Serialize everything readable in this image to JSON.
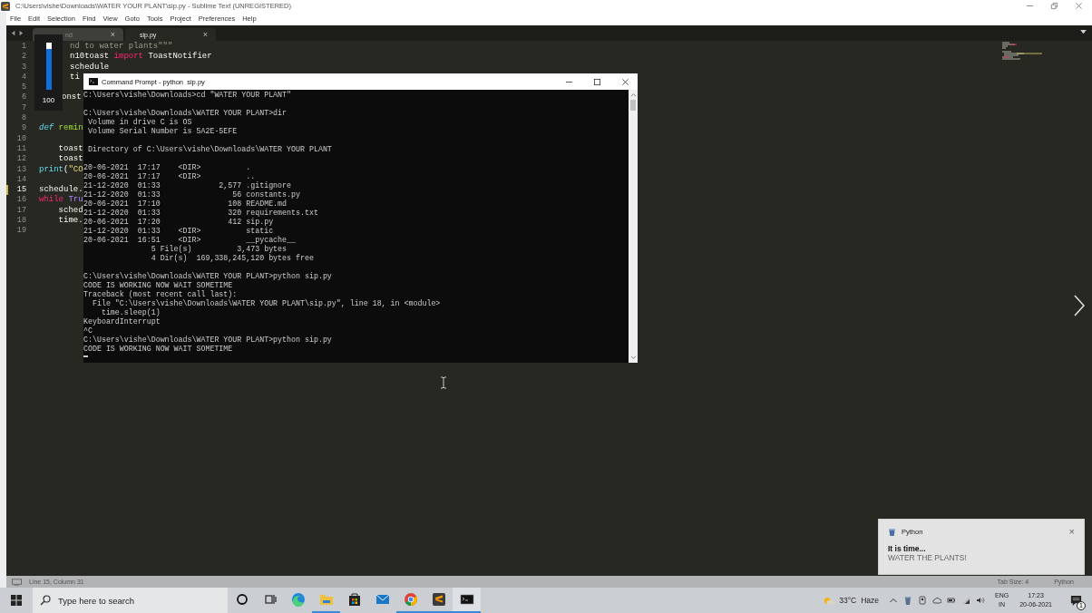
{
  "window": {
    "title": "C:\\Users\\vishe\\Downloads\\WATER YOUR PLANT\\sip.py - Sublime Text (UNREGISTERED)"
  },
  "menu": [
    "File",
    "Edit",
    "Selection",
    "Find",
    "View",
    "Goto",
    "Tools",
    "Project",
    "Preferences",
    "Help"
  ],
  "tabs": [
    {
      "label": "nd",
      "close": "×",
      "selected": false
    },
    {
      "label": "sip.py",
      "close": "×",
      "selected": true
    }
  ],
  "editor": {
    "lines": [
      {
        "number": "1",
        "current": false,
        "segments": [
          {
            "text": "nd to water plants\"\"\"",
            "kind": "comment"
          }
        ]
      },
      {
        "number": "2",
        "current": false,
        "segments": [
          {
            "text": "n10toast ",
            "kind": "plain"
          },
          {
            "text": "import",
            "kind": "keyword"
          },
          {
            "text": " ToastNotifier",
            "kind": "plain"
          }
        ]
      },
      {
        "number": "3",
        "current": false,
        "segments": [
          {
            "text": "schedule",
            "kind": "plain"
          }
        ]
      },
      {
        "number": "4",
        "current": false,
        "segments": [
          {
            "text": "ti",
            "kind": "plain"
          }
        ]
      },
      {
        "number": "5",
        "current": false
      },
      {
        "number": "6",
        "current": false,
        "segments": [
          {
            "text": "onst",
            "kind": "plain"
          }
        ]
      },
      {
        "number": "7",
        "current": false
      },
      {
        "number": "8",
        "current": false
      },
      {
        "number": "9",
        "current": false,
        "segments": [
          {
            "text": "def",
            "kind": "storage"
          },
          {
            "text": " remin",
            "kind": "function"
          }
        ]
      },
      {
        "number": "10",
        "current": false
      },
      {
        "number": "11",
        "current": false,
        "segments": [
          {
            "text": "    toast",
            "kind": "plain"
          }
        ]
      },
      {
        "number": "12",
        "current": false,
        "segments": [
          {
            "text": "    toast",
            "kind": "plain"
          }
        ]
      },
      {
        "number": "13",
        "current": false,
        "segments": [
          {
            "text": "print",
            "kind": "builtin"
          },
          {
            "text": "(",
            "kind": "plain"
          },
          {
            "text": "\"CO",
            "kind": "string"
          }
        ]
      },
      {
        "number": "14",
        "current": false
      },
      {
        "number": "15",
        "current": true,
        "segments": [
          {
            "text": "schedule.",
            "kind": "plain"
          }
        ]
      },
      {
        "number": "16",
        "current": false,
        "segments": [
          {
            "text": "while",
            "kind": "keyword"
          },
          {
            "text": " Tru",
            "kind": "constant"
          }
        ]
      },
      {
        "number": "17",
        "current": false,
        "segments": [
          {
            "text": "    sched",
            "kind": "plain"
          }
        ]
      },
      {
        "number": "18",
        "current": false,
        "segments": [
          {
            "text": "    time.",
            "kind": "plain"
          }
        ]
      },
      {
        "number": "19",
        "current": false
      }
    ]
  },
  "status_bar": {
    "position": "Line 15, Column 31",
    "tab_size": "Tab Size: 4",
    "syntax": "Python"
  },
  "volume_osd": {
    "level": 1,
    "value": "100"
  },
  "console": {
    "title": "Command Prompt - python  sip.py",
    "blocks": [
      [
        "C:\\Users\\vishe\\Downloads>cd \"WATER YOUR PLANT\""
      ],
      [
        "C:\\Users\\vishe\\Downloads\\WATER YOUR PLANT>dir",
        " Volume in drive C is OS",
        " Volume Serial Number is 5A2E-5EFE"
      ],
      [
        " Directory of C:\\Users\\vishe\\Downloads\\WATER YOUR PLANT"
      ],
      [
        "20-06-2021  17:17    <DIR>          .",
        "20-06-2021  17:17    <DIR>          ..",
        "21-12-2020  01:33             2,577 .gitignore",
        "21-12-2020  01:33                56 constants.py",
        "20-06-2021  17:10               108 README.md",
        "21-12-2020  01:33               320 requirements.txt",
        "20-06-2021  17:20               412 sip.py",
        "21-12-2020  01:33    <DIR>          static",
        "20-06-2021  16:51    <DIR>          __pycache__",
        "               5 File(s)          3,473 bytes",
        "               4 Dir(s)  169,338,245,120 bytes free"
      ],
      [
        "C:\\Users\\vishe\\Downloads\\WATER YOUR PLANT>python sip.py",
        "CODE IS WORKING NOW WAIT SOMETIME",
        "Traceback (most recent call last):",
        "  File \"C:\\Users\\vishe\\Downloads\\WATER YOUR PLANT\\sip.py\", line 18, in <module>",
        "    time.sleep(1)",
        "KeyboardInterrupt",
        "^C",
        "C:\\Users\\vishe\\Downloads\\WATER YOUR PLANT>python sip.py",
        "CODE IS WORKING NOW WAIT SOMETIME"
      ]
    ]
  },
  "notification": {
    "app": "Python",
    "close": "×",
    "title": "It is time...",
    "message": "WATER THE PLANTS!"
  },
  "taskbar": {
    "search_placeholder": "Type here to search",
    "apps": [
      {
        "kind": "cortana",
        "running": false,
        "selected": false
      },
      {
        "kind": "taskview",
        "running": false,
        "selected": false
      },
      {
        "kind": "edge",
        "running": false,
        "selected": false
      },
      {
        "kind": "explorer",
        "running": true,
        "selected": false
      },
      {
        "kind": "store",
        "running": false,
        "selected": false
      },
      {
        "kind": "mail",
        "running": false,
        "selected": false
      },
      {
        "kind": "chrome",
        "running": true,
        "selected": false
      },
      {
        "kind": "sublime",
        "running": true,
        "selected": false
      },
      {
        "kind": "terminal",
        "running": true,
        "selected": true
      }
    ],
    "temperature": "33°C",
    "condition": "Haze",
    "language": "ENG",
    "region": "IN",
    "time": "17:23",
    "date": "20-06-2021",
    "notifications": "1"
  }
}
